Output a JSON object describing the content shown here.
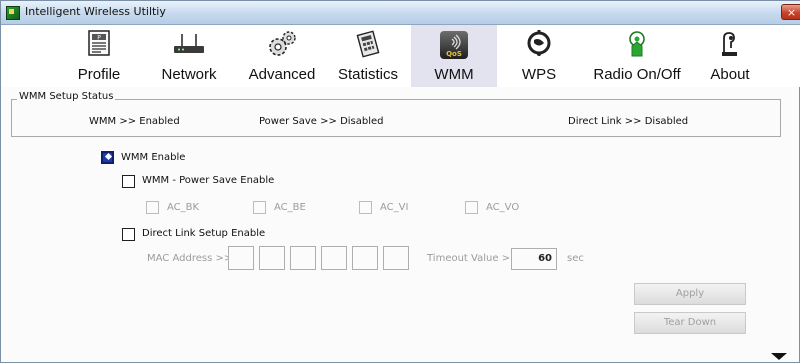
{
  "window": {
    "title": "Intelligent Wireless Utiltiy",
    "close_label": "×"
  },
  "toolbar": {
    "items": [
      {
        "label": "Profile",
        "icon": "profile-icon"
      },
      {
        "label": "Network",
        "icon": "network-icon"
      },
      {
        "label": "Advanced",
        "icon": "advanced-icon"
      },
      {
        "label": "Statistics",
        "icon": "statistics-icon"
      },
      {
        "label": "WMM",
        "icon": "wmm-qos-icon",
        "active": true
      },
      {
        "label": "WPS",
        "icon": "wps-icon"
      },
      {
        "label": "Radio On/Off",
        "icon": "radio-icon"
      },
      {
        "label": "About",
        "icon": "about-icon"
      }
    ]
  },
  "wmm_icon_text": "QoS",
  "status": {
    "legend": "WMM Setup Status",
    "wmm": "WMM >> Enabled",
    "power_save": "Power Save >> Disabled",
    "direct_link": "Direct Link >> Disabled"
  },
  "options": {
    "wmm_enable": {
      "label": "WMM Enable",
      "checked": true
    },
    "power_save_enable": {
      "label": "WMM - Power Save Enable",
      "checked": false
    },
    "ac": [
      "AC_BK",
      "AC_BE",
      "AC_VI",
      "AC_VO"
    ],
    "direct_link_enable": {
      "label": "Direct Link Setup Enable",
      "checked": false
    }
  },
  "direct_link": {
    "mac_label": "MAC Address >>",
    "timeout_label": "Timeout Value >>",
    "timeout_value": "60",
    "timeout_unit": "sec"
  },
  "buttons": {
    "apply": "Apply",
    "tear_down": "Tear Down"
  },
  "colors": {
    "active_tab_bg": "#e3e2ef",
    "checked_blue": "#1c3aa9",
    "disabled_text": "#9c9c9c"
  }
}
